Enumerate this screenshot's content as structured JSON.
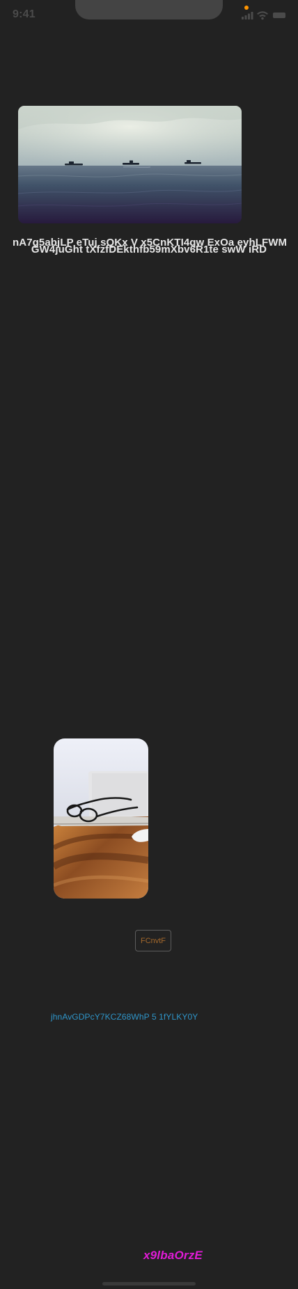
{
  "status_bar": {
    "time": "9:41"
  },
  "hero": {
    "title_line_1": "nA7g5abjLP  eTuj sQKx V x5CnKTI4qw  ExOa eyhLFWM",
    "title_line_2": "GW4juGht tXfzfDEkthfb59mXbv6R1te swW iRD"
  },
  "button": {
    "label": "FCnvtF"
  },
  "link": {
    "text": "jhnAvGDPcY7KCZ68WhP 5 1fYLKY0Y"
  },
  "accent": {
    "text": "x9lbaOrzE"
  },
  "colors": {
    "background": "#222222",
    "status": "#4b4b4b",
    "button_text": "#a5692b",
    "link_text": "#2f95c9",
    "accent_text": "#e11bd7"
  }
}
